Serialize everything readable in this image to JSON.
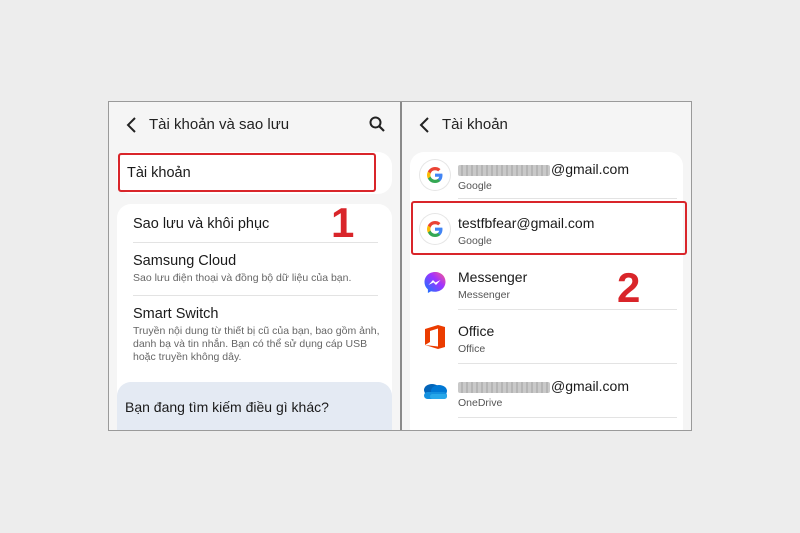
{
  "left": {
    "header": {
      "title": "Tài khoản và sao lưu"
    },
    "accounts_item": {
      "label": "Tài khoản"
    },
    "backup_item": {
      "label": "Sao lưu và khôi phục"
    },
    "samsung_cloud": {
      "label": "Samsung Cloud",
      "sub": "Sao lưu điện thoại và đồng bộ dữ liệu của bạn."
    },
    "smart_switch": {
      "label": "Smart Switch",
      "sub": "Truyền nội dung từ thiết bị cũ của bạn, bao gồm ảnh, danh bạ và tin nhắn. Bạn có thể sử dụng cáp USB hoặc truyền không dây."
    },
    "suggestion": {
      "label": "Bạn đang tìm kiếm điều gì khác?"
    },
    "annotation": "1"
  },
  "right": {
    "header": {
      "title": "Tài khoản"
    },
    "accounts": [
      {
        "email_suffix": "@gmail.com",
        "type": "Google",
        "icon": "google-icon"
      },
      {
        "email": "testfbfear@gmail.com",
        "type": "Google",
        "icon": "google-icon"
      },
      {
        "name": "Messenger",
        "type": "Messenger",
        "icon": "messenger-icon"
      },
      {
        "name": "Office",
        "type": "Office",
        "icon": "office-icon"
      },
      {
        "email_suffix": "@gmail.com",
        "type": "OneDrive",
        "icon": "onedrive-icon"
      }
    ],
    "annotation": "2"
  },
  "colors": {
    "annotation_red": "#d9252a",
    "card_bg": "#ffffff",
    "panel_bg": "#f5f5f5"
  }
}
